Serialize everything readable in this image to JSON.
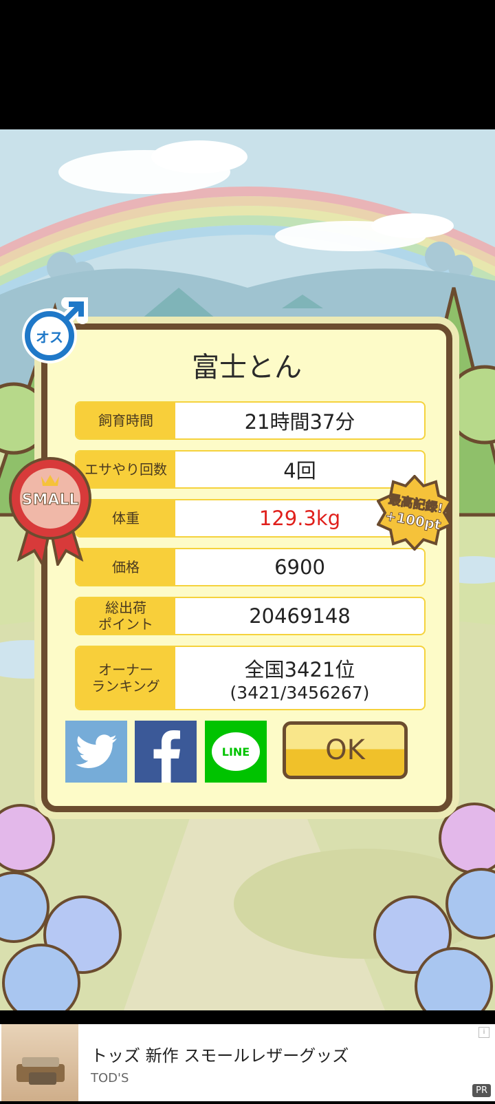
{
  "pet": {
    "name": "富士とん",
    "gender_label": "オス",
    "size_badge": "SMALL",
    "record_badge_line1": "最高記録!",
    "record_badge_line2": "+100pt"
  },
  "stats": [
    {
      "label": "飼育時間",
      "value": "21時間37分"
    },
    {
      "label": "エサやり回数",
      "value": "4回"
    },
    {
      "label": "体重",
      "value": "129.3kg",
      "highlight": "#e0201c"
    },
    {
      "label": "価格",
      "value": "6900"
    },
    {
      "label": "総出荷\nポイント",
      "value": "20469148"
    },
    {
      "label": "オーナー\nランキング",
      "value": "全国3421位",
      "sub": "(3421/3456267)"
    }
  ],
  "share": {
    "twitter_icon": "twitter-icon",
    "facebook_icon": "facebook-icon",
    "line_label": "LINE"
  },
  "ok_label": "OK",
  "ad": {
    "title": "トッズ 新作 スモールレザーグッズ",
    "advertiser": "TOD'S",
    "info": "i",
    "pr": "PR"
  },
  "colors": {
    "panel_border": "#6b4c2f",
    "label_bg": "#f8cf3a",
    "twitter": "#76acd8",
    "facebook": "#3b5998",
    "line": "#00c300"
  }
}
